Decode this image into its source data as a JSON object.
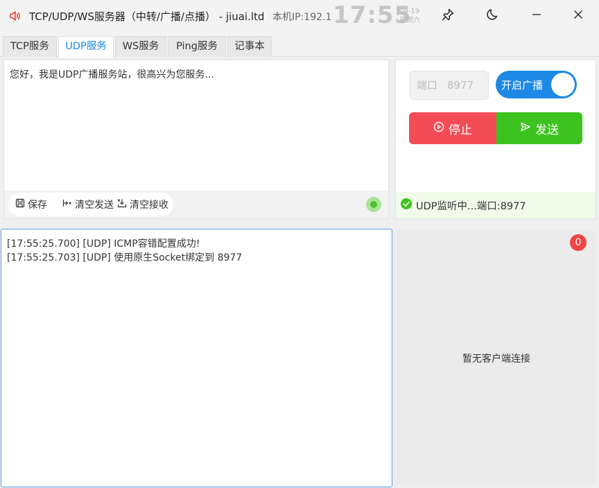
{
  "window": {
    "title": "TCP/UDP/WS服务器（中转/广播/点播） - jiuai.ltd",
    "ip_text": "本机IP:192.1",
    "clock_time": "17:55",
    "clock_date": "09-19",
    "clock_weekday": "星期六",
    "icons": [
      "speaker-icon",
      "pin-icon",
      "moon-icon",
      "minimize-icon",
      "close-icon"
    ]
  },
  "tabs": [
    {
      "label": "TCP服务",
      "active": false
    },
    {
      "label": "UDP服务",
      "active": true
    },
    {
      "label": "WS服务",
      "active": false
    },
    {
      "label": "Ping服务",
      "active": false
    },
    {
      "label": "记事本",
      "active": false
    }
  ],
  "message": {
    "text": "您好，我是UDP广播服务站，很高兴为您服务...",
    "save_label": "保存",
    "clear_send_label": "清空发送",
    "clear_recv_label": "清空接收"
  },
  "control": {
    "port_label": "端口",
    "port_value": "8977",
    "broadcast_label": "开启广播",
    "broadcast_on": true,
    "stop_label": "停止",
    "send_label": "发送",
    "status_text": "UDP监听中...端口:8977",
    "colors": {
      "accent": "#1e88e5",
      "stop": "#f34c56",
      "send": "#3dc31f"
    }
  },
  "log": {
    "lines": [
      "[17:55:25.700] [UDP] ICMP容错配置成功!",
      "[17:55:25.703] [UDP] 使用原生Socket绑定到 8977"
    ]
  },
  "clients": {
    "count": "0",
    "empty_text": "暂无客户端连接"
  }
}
